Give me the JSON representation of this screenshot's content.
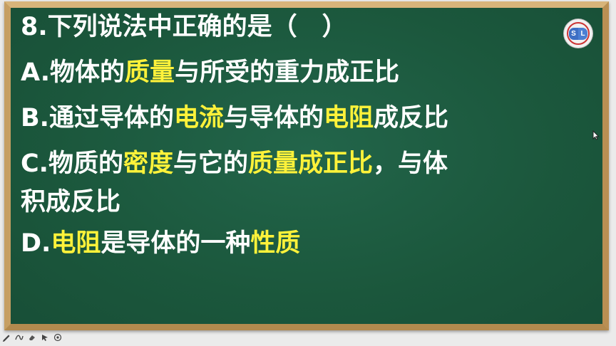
{
  "question": {
    "title": "8.下列说法中正确的是（　）",
    "options": [
      {
        "segments": [
          {
            "text": "A.物体的",
            "highlight": false
          },
          {
            "text": "质量",
            "highlight": true
          },
          {
            "text": "与所受的重力成正比",
            "highlight": false
          }
        ]
      },
      {
        "segments": [
          {
            "text": "B.通过导体的",
            "highlight": false
          },
          {
            "text": "电流",
            "highlight": true
          },
          {
            "text": "与导体的",
            "highlight": false
          },
          {
            "text": "电阻",
            "highlight": true
          },
          {
            "text": "成反比",
            "highlight": false
          }
        ]
      },
      {
        "segments": [
          {
            "text": "C.物质的",
            "highlight": false
          },
          {
            "text": "密度",
            "highlight": true
          },
          {
            "text": "与它的",
            "highlight": false
          },
          {
            "text": "质量成正比",
            "highlight": true
          },
          {
            "text": "，与体",
            "highlight": false
          }
        ],
        "continuation": "积成反比"
      },
      {
        "segments": [
          {
            "text": "D.",
            "highlight": false
          },
          {
            "text": "电阻",
            "highlight": true
          },
          {
            "text": "是导体的一种",
            "highlight": false
          },
          {
            "text": "性质",
            "highlight": true
          }
        ]
      }
    ]
  },
  "logo": {
    "left_letter": "S",
    "right_letter": "L"
  },
  "colors": {
    "board": "#1e5b3f",
    "frame": "#c9a46a",
    "text": "#ffffff",
    "highlight": "#fff23a"
  },
  "toolbar": {
    "icons": [
      "pen-icon",
      "curve-icon",
      "eraser-icon",
      "pointer-icon",
      "target-icon"
    ]
  }
}
